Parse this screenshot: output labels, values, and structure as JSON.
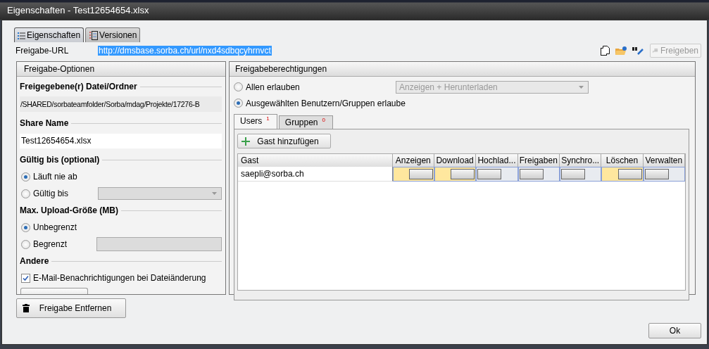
{
  "window": {
    "title": "Eigenschaften - Test12654654.xlsx"
  },
  "tabs": [
    {
      "label": "Eigenschaften",
      "selected": true
    },
    {
      "label": "Versionen",
      "selected": false
    }
  ],
  "share_url": {
    "label": "Freigabe-URL",
    "value": "http://dmsbase.sorba.ch/url/nxd4sdbqcyhrnvct",
    "selected": true
  },
  "share_button": {
    "label": "Freigeben",
    "disabled": true
  },
  "options": {
    "title": "Freigabe-Optionen",
    "file_heading": "Freigegebene(r) Datei/Ordner",
    "file_path": "/SHARED/sorbateamfolder/Sorba/mdag/Projekte/17276-B",
    "share_name_heading": "Share Name",
    "share_name": "Test12654654.xlsx",
    "valid_heading": "Gültig bis (optional)",
    "valid_options": [
      {
        "label": "Läuft nie ab",
        "selected": true,
        "kind": "plain"
      },
      {
        "label": "Gültig bis",
        "selected": false,
        "kind": "dropdown"
      }
    ],
    "upload_heading": "Max. Upload-Größe (MB)",
    "upload_options": [
      {
        "label": "Unbegrenzt",
        "selected": true,
        "kind": "plain"
      },
      {
        "label": "Begrenzt",
        "selected": false,
        "kind": "field"
      }
    ],
    "other_heading": "Andere",
    "email_notify": {
      "label": "E-Mail-Benachrichtigungen bei Dateiänderung",
      "checked": true
    }
  },
  "remove_button": "Freigabe Entfernen",
  "permissions": {
    "title": "Freigabeberechtigungen",
    "modes": [
      {
        "label": "Allen erlauben",
        "selected": false
      },
      {
        "label": "Ausgewählten Benutzern/Gruppen erlaube",
        "selected": true
      }
    ],
    "access_dropdown": {
      "value": "Anzeigen + Herunterladen",
      "disabled": true
    },
    "tabs": [
      {
        "label": "Users",
        "count": "1",
        "selected": true
      },
      {
        "label": "Gruppen",
        "count": "0",
        "selected": false
      }
    ],
    "add_button": "Gast hinzufügen",
    "table": {
      "columns": [
        "Gast",
        "Anzeigen",
        "Download",
        "Hochlad...",
        "Freigaben",
        "Synchro...",
        "Löschen",
        "Verwalten"
      ],
      "rows": [
        {
          "guest": "saepli@sorba.ch",
          "permissions": [
            {
              "on": true
            },
            {
              "on": true
            },
            {
              "on": false
            },
            {
              "on": false
            },
            {
              "on": false
            },
            {
              "on": true
            },
            {
              "on": false
            }
          ]
        }
      ]
    }
  },
  "ok_button": "Ok"
}
